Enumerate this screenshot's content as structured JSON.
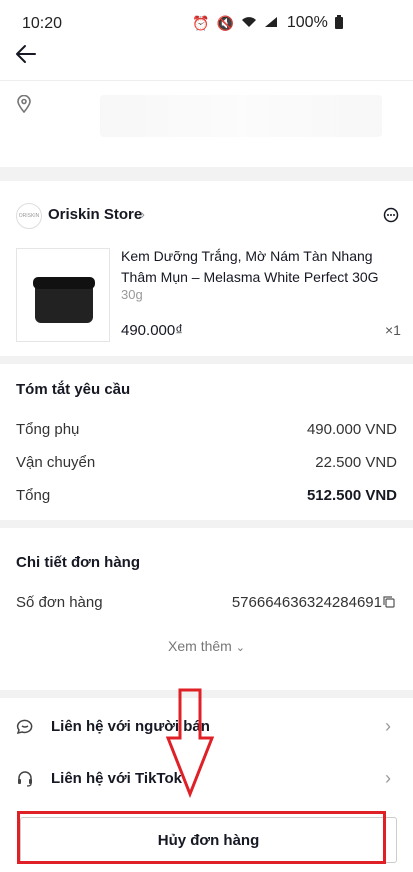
{
  "status_bar": {
    "time": "10:20",
    "battery": "100%",
    "icons": [
      "alarm-icon",
      "mute-icon",
      "wifi-icon",
      "signal-icon",
      "battery-icon"
    ]
  },
  "header": {
    "back_icon": "arrow-left-icon"
  },
  "address": {
    "icon": "location-pin-icon"
  },
  "store": {
    "name": "Oriskin Store",
    "logo_text": "ORISKIN"
  },
  "product": {
    "name": "Kem Dưỡng Trắng, Mờ Nám Tàn Nhang Thâm Mụn – Melasma White Perfect 30G",
    "variant": "30g",
    "price": "490.000₫",
    "qty": "×1"
  },
  "summary": {
    "title": "Tóm tắt yêu cầu",
    "rows": [
      {
        "label": "Tổng phụ",
        "value": "490.000 VND"
      },
      {
        "label": "Vận chuyển",
        "value": "22.500 VND"
      },
      {
        "label": "Tổng",
        "value": "512.500 VND"
      }
    ]
  },
  "details": {
    "title": "Chi tiết đơn hàng",
    "order_label": "Số đơn hàng",
    "order_number": "576664636324284691",
    "see_more": "Xem thêm"
  },
  "contact": {
    "seller": "Liên hệ với người bán",
    "tiktok": "Liên hệ với TikTok"
  },
  "footer": {
    "cancel": "Hủy đơn hàng"
  },
  "annotation": {
    "color": "#e02027"
  }
}
